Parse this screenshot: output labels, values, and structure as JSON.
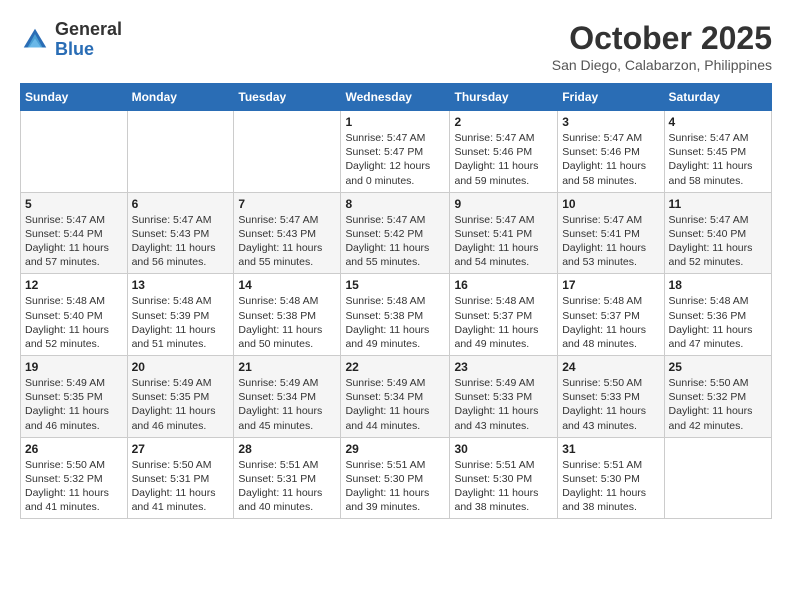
{
  "header": {
    "logo": {
      "general": "General",
      "blue": "Blue"
    },
    "title": "October 2025",
    "location": "San Diego, Calabarzon, Philippines"
  },
  "weekdays": [
    "Sunday",
    "Monday",
    "Tuesday",
    "Wednesday",
    "Thursday",
    "Friday",
    "Saturday"
  ],
  "weeks": [
    [
      {
        "day": "",
        "sunrise": "",
        "sunset": "",
        "daylight": ""
      },
      {
        "day": "",
        "sunrise": "",
        "sunset": "",
        "daylight": ""
      },
      {
        "day": "",
        "sunrise": "",
        "sunset": "",
        "daylight": ""
      },
      {
        "day": "1",
        "sunrise": "Sunrise: 5:47 AM",
        "sunset": "Sunset: 5:47 PM",
        "daylight": "Daylight: 12 hours and 0 minutes."
      },
      {
        "day": "2",
        "sunrise": "Sunrise: 5:47 AM",
        "sunset": "Sunset: 5:46 PM",
        "daylight": "Daylight: 11 hours and 59 minutes."
      },
      {
        "day": "3",
        "sunrise": "Sunrise: 5:47 AM",
        "sunset": "Sunset: 5:46 PM",
        "daylight": "Daylight: 11 hours and 58 minutes."
      },
      {
        "day": "4",
        "sunrise": "Sunrise: 5:47 AM",
        "sunset": "Sunset: 5:45 PM",
        "daylight": "Daylight: 11 hours and 58 minutes."
      }
    ],
    [
      {
        "day": "5",
        "sunrise": "Sunrise: 5:47 AM",
        "sunset": "Sunset: 5:44 PM",
        "daylight": "Daylight: 11 hours and 57 minutes."
      },
      {
        "day": "6",
        "sunrise": "Sunrise: 5:47 AM",
        "sunset": "Sunset: 5:43 PM",
        "daylight": "Daylight: 11 hours and 56 minutes."
      },
      {
        "day": "7",
        "sunrise": "Sunrise: 5:47 AM",
        "sunset": "Sunset: 5:43 PM",
        "daylight": "Daylight: 11 hours and 55 minutes."
      },
      {
        "day": "8",
        "sunrise": "Sunrise: 5:47 AM",
        "sunset": "Sunset: 5:42 PM",
        "daylight": "Daylight: 11 hours and 55 minutes."
      },
      {
        "day": "9",
        "sunrise": "Sunrise: 5:47 AM",
        "sunset": "Sunset: 5:41 PM",
        "daylight": "Daylight: 11 hours and 54 minutes."
      },
      {
        "day": "10",
        "sunrise": "Sunrise: 5:47 AM",
        "sunset": "Sunset: 5:41 PM",
        "daylight": "Daylight: 11 hours and 53 minutes."
      },
      {
        "day": "11",
        "sunrise": "Sunrise: 5:47 AM",
        "sunset": "Sunset: 5:40 PM",
        "daylight": "Daylight: 11 hours and 52 minutes."
      }
    ],
    [
      {
        "day": "12",
        "sunrise": "Sunrise: 5:48 AM",
        "sunset": "Sunset: 5:40 PM",
        "daylight": "Daylight: 11 hours and 52 minutes."
      },
      {
        "day": "13",
        "sunrise": "Sunrise: 5:48 AM",
        "sunset": "Sunset: 5:39 PM",
        "daylight": "Daylight: 11 hours and 51 minutes."
      },
      {
        "day": "14",
        "sunrise": "Sunrise: 5:48 AM",
        "sunset": "Sunset: 5:38 PM",
        "daylight": "Daylight: 11 hours and 50 minutes."
      },
      {
        "day": "15",
        "sunrise": "Sunrise: 5:48 AM",
        "sunset": "Sunset: 5:38 PM",
        "daylight": "Daylight: 11 hours and 49 minutes."
      },
      {
        "day": "16",
        "sunrise": "Sunrise: 5:48 AM",
        "sunset": "Sunset: 5:37 PM",
        "daylight": "Daylight: 11 hours and 49 minutes."
      },
      {
        "day": "17",
        "sunrise": "Sunrise: 5:48 AM",
        "sunset": "Sunset: 5:37 PM",
        "daylight": "Daylight: 11 hours and 48 minutes."
      },
      {
        "day": "18",
        "sunrise": "Sunrise: 5:48 AM",
        "sunset": "Sunset: 5:36 PM",
        "daylight": "Daylight: 11 hours and 47 minutes."
      }
    ],
    [
      {
        "day": "19",
        "sunrise": "Sunrise: 5:49 AM",
        "sunset": "Sunset: 5:35 PM",
        "daylight": "Daylight: 11 hours and 46 minutes."
      },
      {
        "day": "20",
        "sunrise": "Sunrise: 5:49 AM",
        "sunset": "Sunset: 5:35 PM",
        "daylight": "Daylight: 11 hours and 46 minutes."
      },
      {
        "day": "21",
        "sunrise": "Sunrise: 5:49 AM",
        "sunset": "Sunset: 5:34 PM",
        "daylight": "Daylight: 11 hours and 45 minutes."
      },
      {
        "day": "22",
        "sunrise": "Sunrise: 5:49 AM",
        "sunset": "Sunset: 5:34 PM",
        "daylight": "Daylight: 11 hours and 44 minutes."
      },
      {
        "day": "23",
        "sunrise": "Sunrise: 5:49 AM",
        "sunset": "Sunset: 5:33 PM",
        "daylight": "Daylight: 11 hours and 43 minutes."
      },
      {
        "day": "24",
        "sunrise": "Sunrise: 5:50 AM",
        "sunset": "Sunset: 5:33 PM",
        "daylight": "Daylight: 11 hours and 43 minutes."
      },
      {
        "day": "25",
        "sunrise": "Sunrise: 5:50 AM",
        "sunset": "Sunset: 5:32 PM",
        "daylight": "Daylight: 11 hours and 42 minutes."
      }
    ],
    [
      {
        "day": "26",
        "sunrise": "Sunrise: 5:50 AM",
        "sunset": "Sunset: 5:32 PM",
        "daylight": "Daylight: 11 hours and 41 minutes."
      },
      {
        "day": "27",
        "sunrise": "Sunrise: 5:50 AM",
        "sunset": "Sunset: 5:31 PM",
        "daylight": "Daylight: 11 hours and 41 minutes."
      },
      {
        "day": "28",
        "sunrise": "Sunrise: 5:51 AM",
        "sunset": "Sunset: 5:31 PM",
        "daylight": "Daylight: 11 hours and 40 minutes."
      },
      {
        "day": "29",
        "sunrise": "Sunrise: 5:51 AM",
        "sunset": "Sunset: 5:30 PM",
        "daylight": "Daylight: 11 hours and 39 minutes."
      },
      {
        "day": "30",
        "sunrise": "Sunrise: 5:51 AM",
        "sunset": "Sunset: 5:30 PM",
        "daylight": "Daylight: 11 hours and 38 minutes."
      },
      {
        "day": "31",
        "sunrise": "Sunrise: 5:51 AM",
        "sunset": "Sunset: 5:30 PM",
        "daylight": "Daylight: 11 hours and 38 minutes."
      },
      {
        "day": "",
        "sunrise": "",
        "sunset": "",
        "daylight": ""
      }
    ]
  ]
}
